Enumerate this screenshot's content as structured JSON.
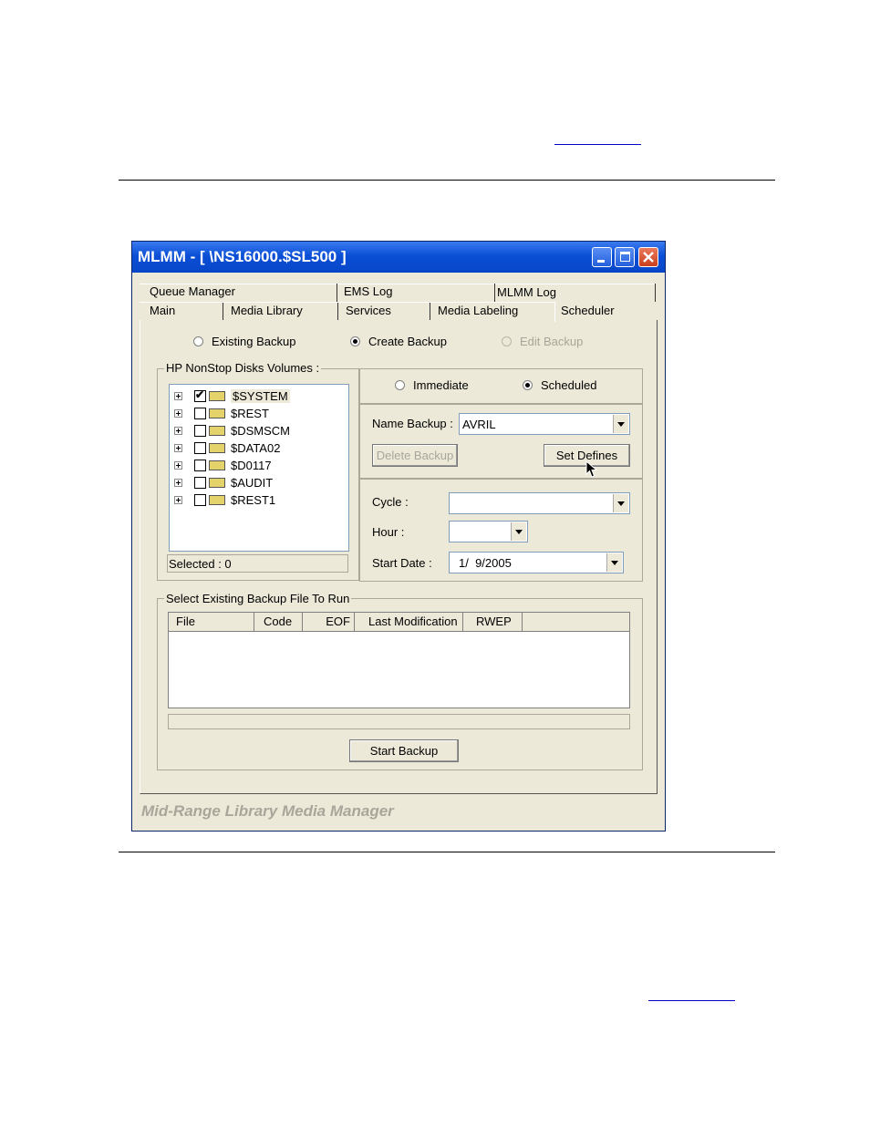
{
  "window": {
    "title": "MLMM - [ \\NS16000.$SL500 ]"
  },
  "tabs": {
    "row1": [
      "Queue Manager",
      "EMS Log",
      "MLMM Log"
    ],
    "row2": [
      "Main",
      "Media Library",
      "Services",
      "Media Labeling",
      "Scheduler"
    ],
    "active": "Scheduler"
  },
  "mode": {
    "existing": "Existing Backup",
    "create": "Create Backup",
    "edit": "Edit Backup",
    "selected": "create"
  },
  "disks": {
    "title": "HP NonStop Disks Volumes :",
    "items": [
      {
        "label": "$SYSTEM",
        "checked": true
      },
      {
        "label": "$REST",
        "checked": false
      },
      {
        "label": "$DSMSCM",
        "checked": false
      },
      {
        "label": "$DATA02",
        "checked": false
      },
      {
        "label": "$D0117",
        "checked": false
      },
      {
        "label": "$AUDIT",
        "checked": false
      },
      {
        "label": "$REST1",
        "checked": false
      }
    ],
    "selected_text": "Selected : 0"
  },
  "timing": {
    "immediate": "Immediate",
    "scheduled": "Scheduled",
    "selected": "scheduled"
  },
  "backup": {
    "name_label": "Name Backup :",
    "name_value": "AVRIL",
    "delete_label": "Delete Backup",
    "set_defines_label": "Set Defines"
  },
  "schedule": {
    "cycle_label": "Cycle :",
    "cycle_value": "",
    "hour_label": "Hour :",
    "hour_value": "",
    "start_date_label": "Start Date :",
    "start_date_value": "1/  9/2005"
  },
  "existing_files": {
    "title": "Select Existing Backup File To Run",
    "columns": [
      "File",
      "Code",
      "EOF",
      "Last Modification",
      "RWEP"
    ],
    "rows": []
  },
  "start_backup_label": "Start Backup",
  "footer": "Mid-Range Library Media Manager",
  "colors": {
    "titlebar": "#0a4fd6",
    "window_bg": "#ece9d8",
    "link": "#0000cc"
  }
}
